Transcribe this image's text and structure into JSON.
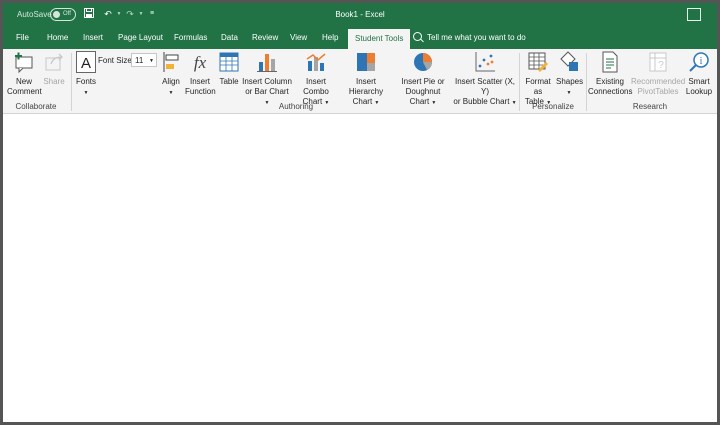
{
  "titlebar": {
    "autosave_label": "AutoSave",
    "autosave_state": "Off",
    "document_title": "Book1  -  Excel",
    "background_color": "#217346"
  },
  "tabs": [
    {
      "label": "File"
    },
    {
      "label": "Home"
    },
    {
      "label": "Insert"
    },
    {
      "label": "Page Layout"
    },
    {
      "label": "Formulas"
    },
    {
      "label": "Data"
    },
    {
      "label": "Review"
    },
    {
      "label": "View"
    },
    {
      "label": "Help"
    },
    {
      "label": "Student Tools",
      "active": true
    }
  ],
  "tell_me": "Tell me what you want to do",
  "ribbon": {
    "collaborate": {
      "group_label": "Collaborate",
      "new_comment_1": "New",
      "new_comment_2": "Comment",
      "share": "Share"
    },
    "authoring": {
      "group_label": "Authoring",
      "fonts": "Fonts",
      "font_size_label": "Font Size:",
      "font_size_value": "11",
      "align": "Align",
      "insert_function_1": "Insert",
      "insert_function_2": "Function",
      "table": "Table",
      "column_chart_1": "Insert Column",
      "column_chart_2": "or Bar Chart",
      "combo_chart_1": "Insert Combo",
      "combo_chart_2": "Chart",
      "hierarchy_chart_1": "Insert Hierarchy",
      "hierarchy_chart_2": "Chart",
      "pie_chart_1": "Insert Pie or",
      "pie_chart_2": "Doughnut Chart",
      "scatter_chart_1": "Insert Scatter (X, Y)",
      "scatter_chart_2": "or Bubble Chart"
    },
    "personalize": {
      "group_label": "Personalize",
      "format_table_1": "Format as",
      "format_table_2": "Table",
      "shapes": "Shapes"
    },
    "research": {
      "group_label": "Research",
      "existing_connections_1": "Existing",
      "existing_connections_2": "Connections",
      "recommended_pivot_1": "Recommended",
      "recommended_pivot_2": "PivotTables",
      "smart_lookup_1": "Smart",
      "smart_lookup_2": "Lookup"
    }
  }
}
